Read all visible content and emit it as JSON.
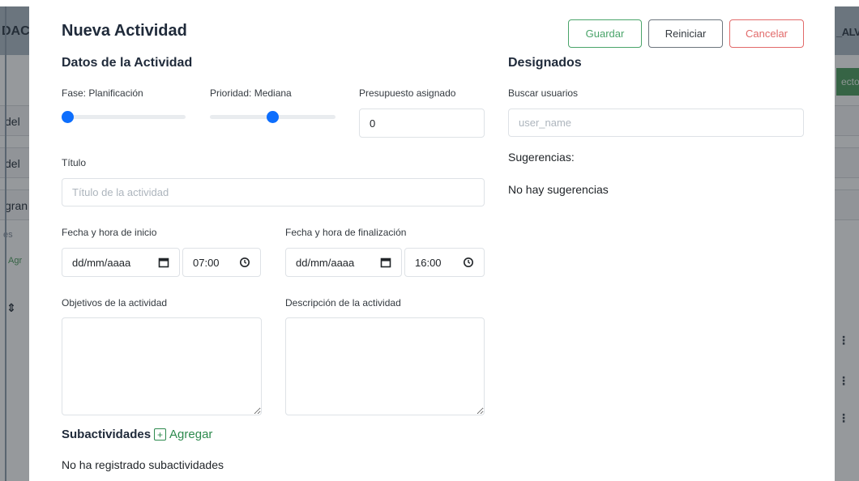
{
  "background": {
    "left_title": "DAC",
    "right_title": "_ALV",
    "green_button": "ecto",
    "rows": [
      "del",
      "del",
      "gran"
    ],
    "small_text": "es",
    "green_text": "Agr"
  },
  "modal": {
    "title": "Nueva Actividad",
    "buttons": {
      "save": "Guardar",
      "reset": "Reiniciar",
      "cancel": "Cancelar"
    },
    "activity_section": {
      "title": "Datos de la Actividad",
      "phase": {
        "label": "Fase: Planificación",
        "value_fraction": 0.0
      },
      "priority": {
        "label": "Prioridad: Mediana",
        "value_fraction": 0.5
      },
      "budget": {
        "label": "Presupuesto asignado",
        "value": "0"
      },
      "title_field": {
        "label": "Título",
        "placeholder": "Título de la actividad"
      },
      "start": {
        "label": "Fecha y hora de inicio",
        "date": "dd/mm/aaaa",
        "time": "07:00"
      },
      "end": {
        "label": "Fecha y hora de finalización",
        "date": "dd/mm/aaaa",
        "time": "16:00"
      },
      "objectives": {
        "label": "Objetivos de la actividad"
      },
      "description": {
        "label": "Descripción de la actividad"
      }
    },
    "subactivities": {
      "title": "Subactividades",
      "add_label": "Agregar",
      "empty": "No ha registrado subactividades"
    },
    "assignees": {
      "title": "Designados",
      "search_label": "Buscar usuarios",
      "search_placeholder": "user_name",
      "suggestions_label": "Sugerencias:",
      "no_suggestions": "No hay sugerencias"
    }
  },
  "colors": {
    "save": "#4aa46a",
    "cancel": "#e26a6a",
    "slider": "#0d6efd",
    "add_link": "#2d8a4e"
  },
  "icons": [
    "calendar-icon",
    "clock-icon",
    "plus-square-icon"
  ]
}
